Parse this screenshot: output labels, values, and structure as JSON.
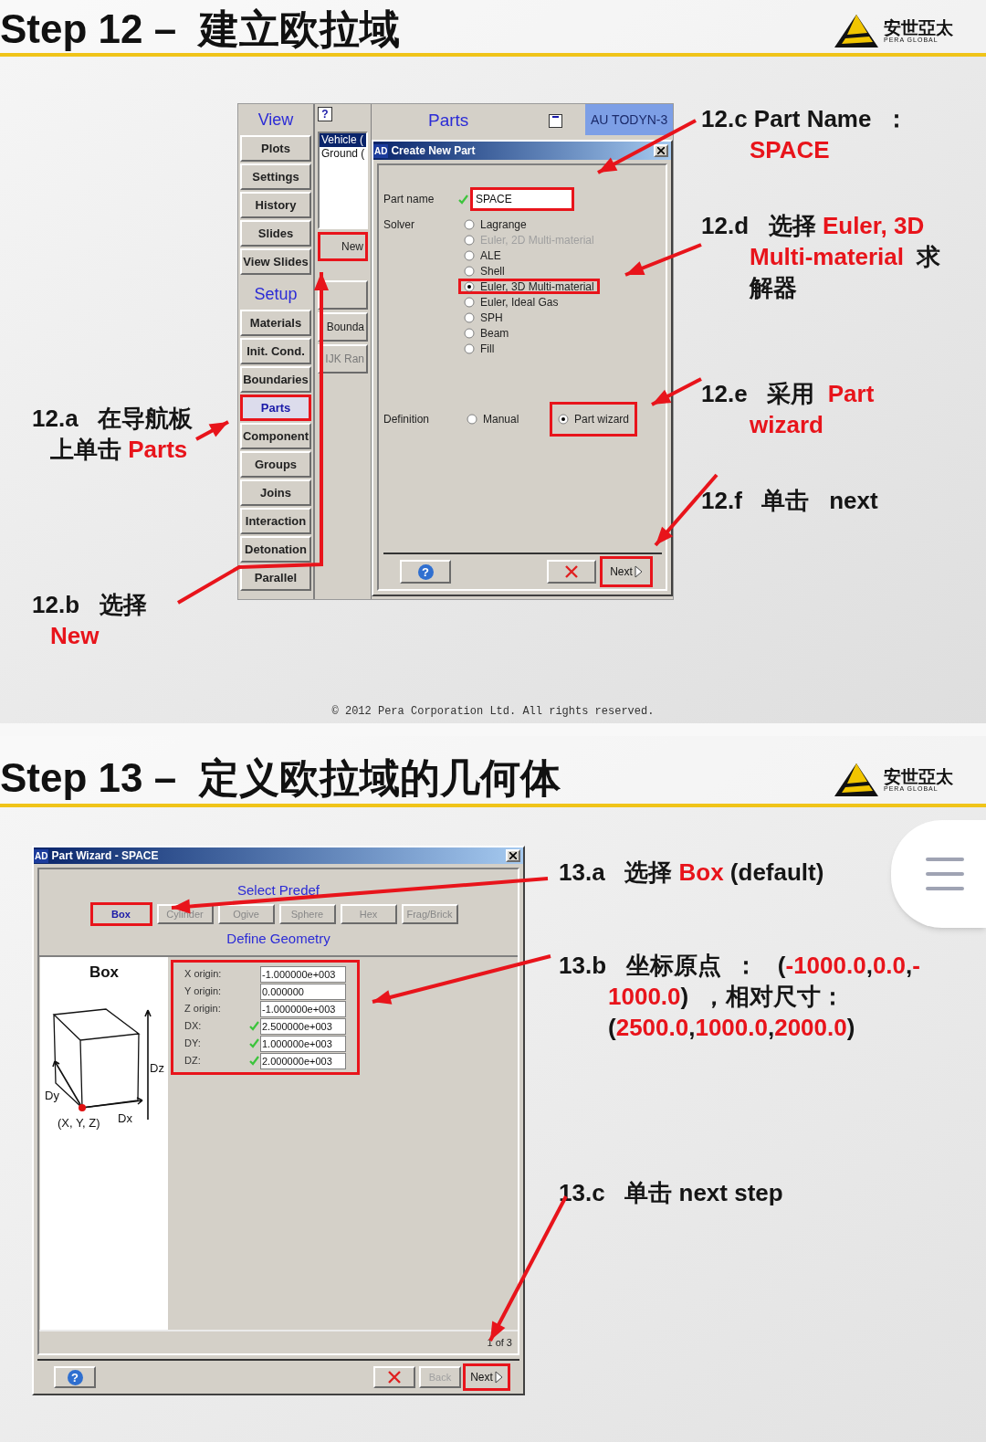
{
  "step_12": {
    "title": "Step 12 –  建立欧拉域",
    "logo": {
      "name": "安世亞太",
      "tagline": "PERA GLOBAL"
    },
    "app": {
      "nav": [
        {
          "kind": "header",
          "label": "View"
        },
        {
          "kind": "button",
          "label": "Plots",
          "selected": false,
          "highlighted": false
        },
        {
          "kind": "button",
          "label": "Settings",
          "selected": false,
          "highlighted": false
        },
        {
          "kind": "button",
          "label": "History",
          "selected": false,
          "highlighted": false
        },
        {
          "kind": "button",
          "label": "Slides",
          "selected": false,
          "highlighted": false
        },
        {
          "kind": "button",
          "label": "View Slides",
          "selected": false,
          "highlighted": false
        },
        {
          "kind": "header",
          "label": "Setup"
        },
        {
          "kind": "button",
          "label": "Materials",
          "selected": false,
          "highlighted": false
        },
        {
          "kind": "button",
          "label": "Init. Cond.",
          "selected": false,
          "highlighted": false
        },
        {
          "kind": "button",
          "label": "Boundaries",
          "selected": false,
          "highlighted": false
        },
        {
          "kind": "button",
          "label": "Parts",
          "selected": true,
          "highlighted": true
        },
        {
          "kind": "button",
          "label": "Component",
          "selected": false,
          "highlighted": false
        },
        {
          "kind": "button",
          "label": "Groups",
          "selected": false,
          "highlighted": false
        },
        {
          "kind": "button",
          "label": "Joins",
          "selected": false,
          "highlighted": false
        },
        {
          "kind": "button",
          "label": "Interaction",
          "selected": false,
          "highlighted": false
        },
        {
          "kind": "button",
          "label": "Detonation",
          "selected": false,
          "highlighted": false
        },
        {
          "kind": "button",
          "label": "Parallel",
          "selected": false,
          "highlighted": false
        }
      ],
      "help": "?",
      "panel_title": "Parts",
      "product_tab": "AU TODYN-3",
      "list": [
        {
          "label": "Vehicle (",
          "selected": true
        },
        {
          "label": "Ground (",
          "selected": false
        }
      ],
      "side_buttons": [
        {
          "label": "New",
          "highlighted": true,
          "disabled": false
        },
        {
          "highlighted": false
        },
        {
          "label": "Bounda",
          "highlighted": false,
          "disabled": false
        },
        {
          "label": "IJK Ran",
          "highlighted": false,
          "disabled": true
        }
      ],
      "dialog": {
        "badge": "AD",
        "title": "Create New Part",
        "part_name": {
          "label": "Part name",
          "value": "SPACE",
          "valid": true,
          "highlighted": true
        },
        "solver": {
          "label": "Solver",
          "options": [
            {
              "label": "Lagrange",
              "selected": false,
              "disabled": false,
              "highlighted": false
            },
            {
              "label": "Euler, 2D Multi-material",
              "selected": false,
              "disabled": true,
              "highlighted": false
            },
            {
              "label": "ALE",
              "selected": false,
              "disabled": false,
              "highlighted": false
            },
            {
              "label": "Shell",
              "selected": false,
              "disabled": false,
              "highlighted": false
            },
            {
              "label": "Euler, 3D Multi-material",
              "selected": true,
              "disabled": false,
              "highlighted": true
            },
            {
              "label": "Euler, Ideal Gas",
              "selected": false,
              "disabled": false,
              "highlighted": false
            },
            {
              "label": "SPH",
              "selected": false,
              "disabled": false,
              "highlighted": false
            },
            {
              "label": "Beam",
              "selected": false,
              "disabled": false,
              "highlighted": false
            },
            {
              "label": "Fill",
              "selected": false,
              "disabled": false,
              "highlighted": false
            }
          ]
        },
        "definition": {
          "label": "Definition",
          "options": [
            {
              "label": "Manual",
              "selected": false,
              "highlighted": false
            },
            {
              "label": "Part wizard",
              "selected": true,
              "highlighted": true
            }
          ]
        },
        "help": "?",
        "next": {
          "label": "Next",
          "highlighted": true
        }
      }
    },
    "callouts": [
      {
        "lines": [
          [
            {
              "text": "12.c Part Name  ：",
              "highlight": false
            }
          ],
          [
            {
              "text": "SPACE",
              "highlight": true
            }
          ]
        ]
      },
      {
        "lines": [
          [
            {
              "text": "12.d   选择 ",
              "highlight": false
            },
            {
              "text": "Euler, 3D",
              "highlight": true
            }
          ],
          [
            {
              "text": "Multi-material",
              "highlight": true
            },
            {
              "text": "  求",
              "highlight": false
            }
          ],
          [
            {
              "text": "解器",
              "highlight": false
            }
          ]
        ]
      },
      {
        "lines": [
          [
            {
              "text": "12.e   采用  ",
              "highlight": false
            },
            {
              "text": "Part",
              "highlight": true
            }
          ],
          [
            {
              "text": "wizard",
              "highlight": true
            }
          ]
        ]
      },
      {
        "lines": [
          [
            {
              "text": "12.a   在导航板",
              "highlight": false
            }
          ],
          [
            {
              "text": "上单击 ",
              "highlight": false
            },
            {
              "text": "Parts",
              "highlight": true
            }
          ]
        ]
      },
      {
        "lines": [
          [
            {
              "text": "12.f   单击   next",
              "highlight": false
            }
          ]
        ]
      },
      {
        "lines": [
          [
            {
              "text": "12.b   选择",
              "highlight": false
            }
          ],
          [
            {
              "text": "New",
              "highlight": true
            }
          ]
        ]
      }
    ],
    "footer": "© 2012 Pera Corporation Ltd. All rights reserved."
  },
  "step_13": {
    "title": "Step 13 –  定义欧拉域的几何体",
    "logo": {
      "name": "安世亞太",
      "tagline": "PERA GLOBAL"
    },
    "wizard": {
      "badge": "AD",
      "title": "Part Wizard - SPACE",
      "predef_title": "Select Predef",
      "predefs": [
        {
          "label": "Box",
          "selected": true,
          "disabled": false,
          "highlighted": true
        },
        {
          "label": "Cylinder",
          "selected": false,
          "disabled": true,
          "highlighted": false
        },
        {
          "label": "Ogive",
          "selected": false,
          "disabled": true,
          "highlighted": false
        },
        {
          "label": "Sphere",
          "selected": false,
          "disabled": true,
          "highlighted": false
        },
        {
          "label": "Hex",
          "selected": false,
          "disabled": true,
          "highlighted": false
        },
        {
          "label": "Frag/Brick",
          "selected": false,
          "disabled": true,
          "highlighted": false
        }
      ],
      "geometry_title": "Define Geometry",
      "preview": {
        "title": "Box",
        "dz": "Dz",
        "dy": "Dy",
        "dx": "Dx",
        "origin": "(X, Y, Z)"
      },
      "fields_highlighted": true,
      "fields": [
        {
          "label": "X origin:",
          "value": "-1.000000e+003",
          "valid": false
        },
        {
          "label": "Y origin:",
          "value": "0.000000",
          "valid": false
        },
        {
          "label": "Z origin:",
          "value": "-1.000000e+003",
          "valid": false
        },
        {
          "label": "DX:",
          "value": "2.500000e+003",
          "valid": true
        },
        {
          "label": "DY:",
          "value": "1.000000e+003",
          "valid": true
        },
        {
          "label": "DZ:",
          "value": "2.000000e+003",
          "valid": true
        }
      ],
      "page": "1 of 3",
      "help": "?",
      "back": {
        "label": "Back",
        "disabled": true
      },
      "next": {
        "label": "Next",
        "highlighted": true
      }
    },
    "callouts": [
      {
        "lines": [
          [
            {
              "text": "13.a   选择 ",
              "highlight": false
            },
            {
              "text": "Box",
              "highlight": true
            },
            {
              "text": " (default)",
              "highlight": false
            }
          ]
        ]
      },
      {
        "lines": [
          [
            {
              "text": "13.b   坐标原点  ：   (",
              "highlight": false
            },
            {
              "text": "-1000.0",
              "highlight": true
            },
            {
              "text": ",",
              "highlight": false
            },
            {
              "text": "0.0",
              "highlight": true
            },
            {
              "text": ",",
              "highlight": false
            },
            {
              "text": "-",
              "highlight": true
            }
          ],
          [
            {
              "text": "1000.0",
              "highlight": true
            },
            {
              "text": ")  ，相对尺寸：",
              "highlight": false
            }
          ],
          [
            {
              "text": "(",
              "highlight": false
            },
            {
              "text": "2500.0",
              "highlight": true
            },
            {
              "text": ",",
              "highlight": false
            },
            {
              "text": "1000.0",
              "highlight": true
            },
            {
              "text": ",",
              "highlight": false
            },
            {
              "text": "2000.0",
              "highlight": true
            },
            {
              "text": ")",
              "highlight": false
            }
          ]
        ]
      },
      {
        "lines": [
          [
            {
              "text": "13.c   单击 next step",
              "highlight": false
            }
          ]
        ]
      }
    ]
  }
}
